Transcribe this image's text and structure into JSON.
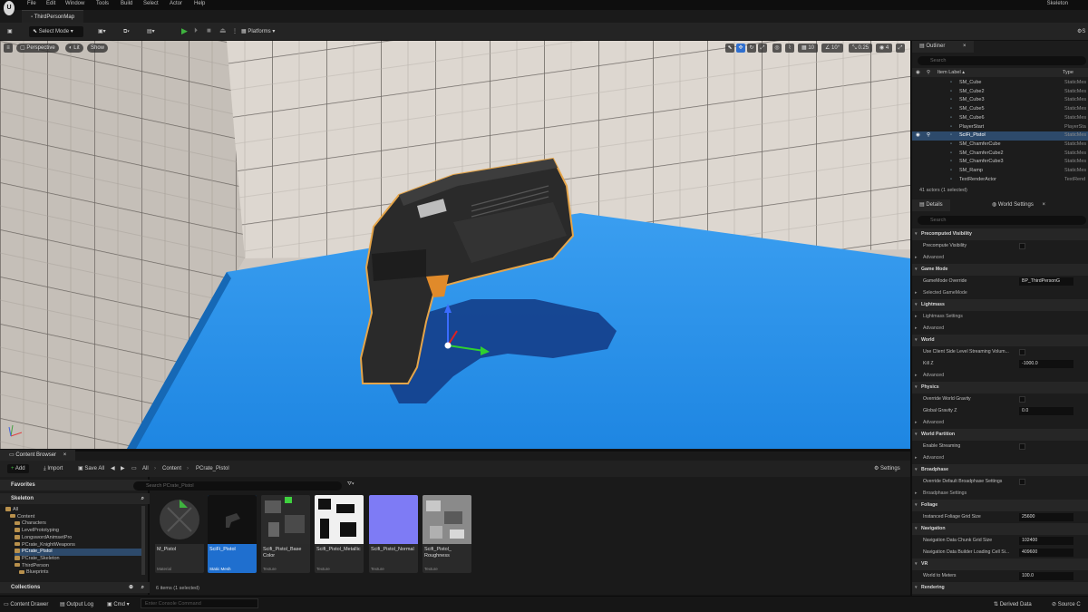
{
  "menu": [
    "File",
    "Edit",
    "Window",
    "Tools",
    "Build",
    "Select",
    "Actor",
    "Help"
  ],
  "map_tab": "ThirdPersonMap",
  "project_name": "Skeleton",
  "toolbar": {
    "select_mode": "Select Mode",
    "platforms": "Platforms",
    "settings_short": "S"
  },
  "viewport": {
    "perspective": "Perspective",
    "lit": "Lit",
    "show": "Show",
    "snap_grid": "10",
    "snap_angle": "10°",
    "snap_scale": "0.25",
    "camera_speed": "4"
  },
  "outliner": {
    "tab": "Outliner",
    "search_placeholder": "Search",
    "col_label": "Item Label ▴",
    "col_type": "Type",
    "rows": [
      {
        "label": "SM_Cube",
        "type": "StaticMes"
      },
      {
        "label": "SM_Cube2",
        "type": "StaticMes"
      },
      {
        "label": "SM_Cube3",
        "type": "StaticMes"
      },
      {
        "label": "SM_Cube5",
        "type": "StaticMes"
      },
      {
        "label": "SM_Cube6",
        "type": "StaticMes"
      },
      {
        "label": "PlayerStart",
        "type": "PlayerSta"
      },
      {
        "label": "SciFi_Pistol",
        "type": "StaticMes"
      },
      {
        "label": "SM_ChamferCube",
        "type": "StaticMes"
      },
      {
        "label": "SM_ChamferCube2",
        "type": "StaticMes"
      },
      {
        "label": "SM_ChamferCube3",
        "type": "StaticMes"
      },
      {
        "label": "SM_Ramp",
        "type": "StaticMes"
      },
      {
        "label": "TextRenderActor",
        "type": "TextRend"
      }
    ],
    "footer": "41 actors (1 selected)"
  },
  "details": {
    "tab_details": "Details",
    "tab_world": "World Settings",
    "search_placeholder": "Search",
    "rows": [
      {
        "kind": "sec",
        "label": "Precomputed Visibility"
      },
      {
        "kind": "cb",
        "label": "Precompute Visibility"
      },
      {
        "kind": "adv",
        "label": "Advanced"
      },
      {
        "kind": "sec",
        "label": "Game Mode"
      },
      {
        "kind": "val",
        "label": "GameMode Override",
        "value": "BP_ThirdPersonG"
      },
      {
        "kind": "adv",
        "label": "Selected GameMode"
      },
      {
        "kind": "sec",
        "label": "Lightmass"
      },
      {
        "kind": "adv",
        "label": "Lightmass Settings"
      },
      {
        "kind": "adv",
        "label": "Advanced"
      },
      {
        "kind": "sec",
        "label": "World"
      },
      {
        "kind": "cb",
        "label": "Use Client Side Level Streaming Volum..."
      },
      {
        "kind": "val",
        "label": "Kill Z",
        "value": "-1000.0"
      },
      {
        "kind": "adv",
        "label": "Advanced"
      },
      {
        "kind": "sec",
        "label": "Physics"
      },
      {
        "kind": "cb",
        "label": "Override World Gravity"
      },
      {
        "kind": "val",
        "label": "Global Gravity Z",
        "value": "0.0"
      },
      {
        "kind": "adv",
        "label": "Advanced"
      },
      {
        "kind": "sec",
        "label": "World Partition"
      },
      {
        "kind": "cb",
        "label": "Enable Streaming"
      },
      {
        "kind": "adv",
        "label": "Advanced"
      },
      {
        "kind": "sec",
        "label": "Broadphase"
      },
      {
        "kind": "cb",
        "label": "Override Default Broadphase Settings"
      },
      {
        "kind": "adv",
        "label": "Broadphase Settings"
      },
      {
        "kind": "sec",
        "label": "Foliage"
      },
      {
        "kind": "val",
        "label": "Instanced Foliage Grid Size",
        "value": "25600"
      },
      {
        "kind": "sec",
        "label": "Navigation"
      },
      {
        "kind": "val",
        "label": "Navigation Data Chunk Grid Size",
        "value": "102400"
      },
      {
        "kind": "val",
        "label": "Navigation Data Builder Loading Cell Si...",
        "value": "409600"
      },
      {
        "kind": "sec",
        "label": "VR"
      },
      {
        "kind": "val",
        "label": "World to Meters",
        "value": "100.0"
      },
      {
        "kind": "sec",
        "label": "Rendering"
      }
    ]
  },
  "content_browser": {
    "tab": "Content Browser",
    "add": "Add",
    "import": "Import",
    "save_all": "Save All",
    "path": [
      "All",
      "Content",
      "PCrate_Pistol"
    ],
    "settings": "Settings",
    "favorites": "Favorites",
    "project": "Skeleton",
    "collections": "Collections",
    "search_placeholder": "Search PCrate_Pistol",
    "tree": [
      {
        "label": "All",
        "indent": 0
      },
      {
        "label": "Content",
        "indent": 1
      },
      {
        "label": "Characters",
        "indent": 2
      },
      {
        "label": "LevelPrototyping",
        "indent": 2
      },
      {
        "label": "LongswordAnimsetPro",
        "indent": 2
      },
      {
        "label": "PCrate_KnightWeapons",
        "indent": 2
      },
      {
        "label": "PCrate_Pistol",
        "indent": 2,
        "selected": true
      },
      {
        "label": "PCrate_Skeleton",
        "indent": 2
      },
      {
        "label": "ThirdPerson",
        "indent": 2
      },
      {
        "label": "Blueprints",
        "indent": 3
      }
    ],
    "assets": [
      {
        "name": "M_Pistol",
        "type": "Material"
      },
      {
        "name": "SciFi_Pistol",
        "type": "Static Mesh",
        "selected": true
      },
      {
        "name": "Scifi_Pistol_Base Color",
        "type": "Texture"
      },
      {
        "name": "Scifi_Pistol_Metallic",
        "type": "Texture"
      },
      {
        "name": "Scifi_Pistol_Normal",
        "type": "Texture"
      },
      {
        "name": "Scifi_Pistol_ Roughness",
        "type": "Texture"
      }
    ],
    "count": "6 items (1 selected)"
  },
  "statusbar": {
    "content_drawer": "Content Drawer",
    "output_log": "Output Log",
    "cmd": "Cmd",
    "console_placeholder": "Enter Console Command",
    "derived_data": "Derived Data",
    "source_control": "Source C"
  }
}
